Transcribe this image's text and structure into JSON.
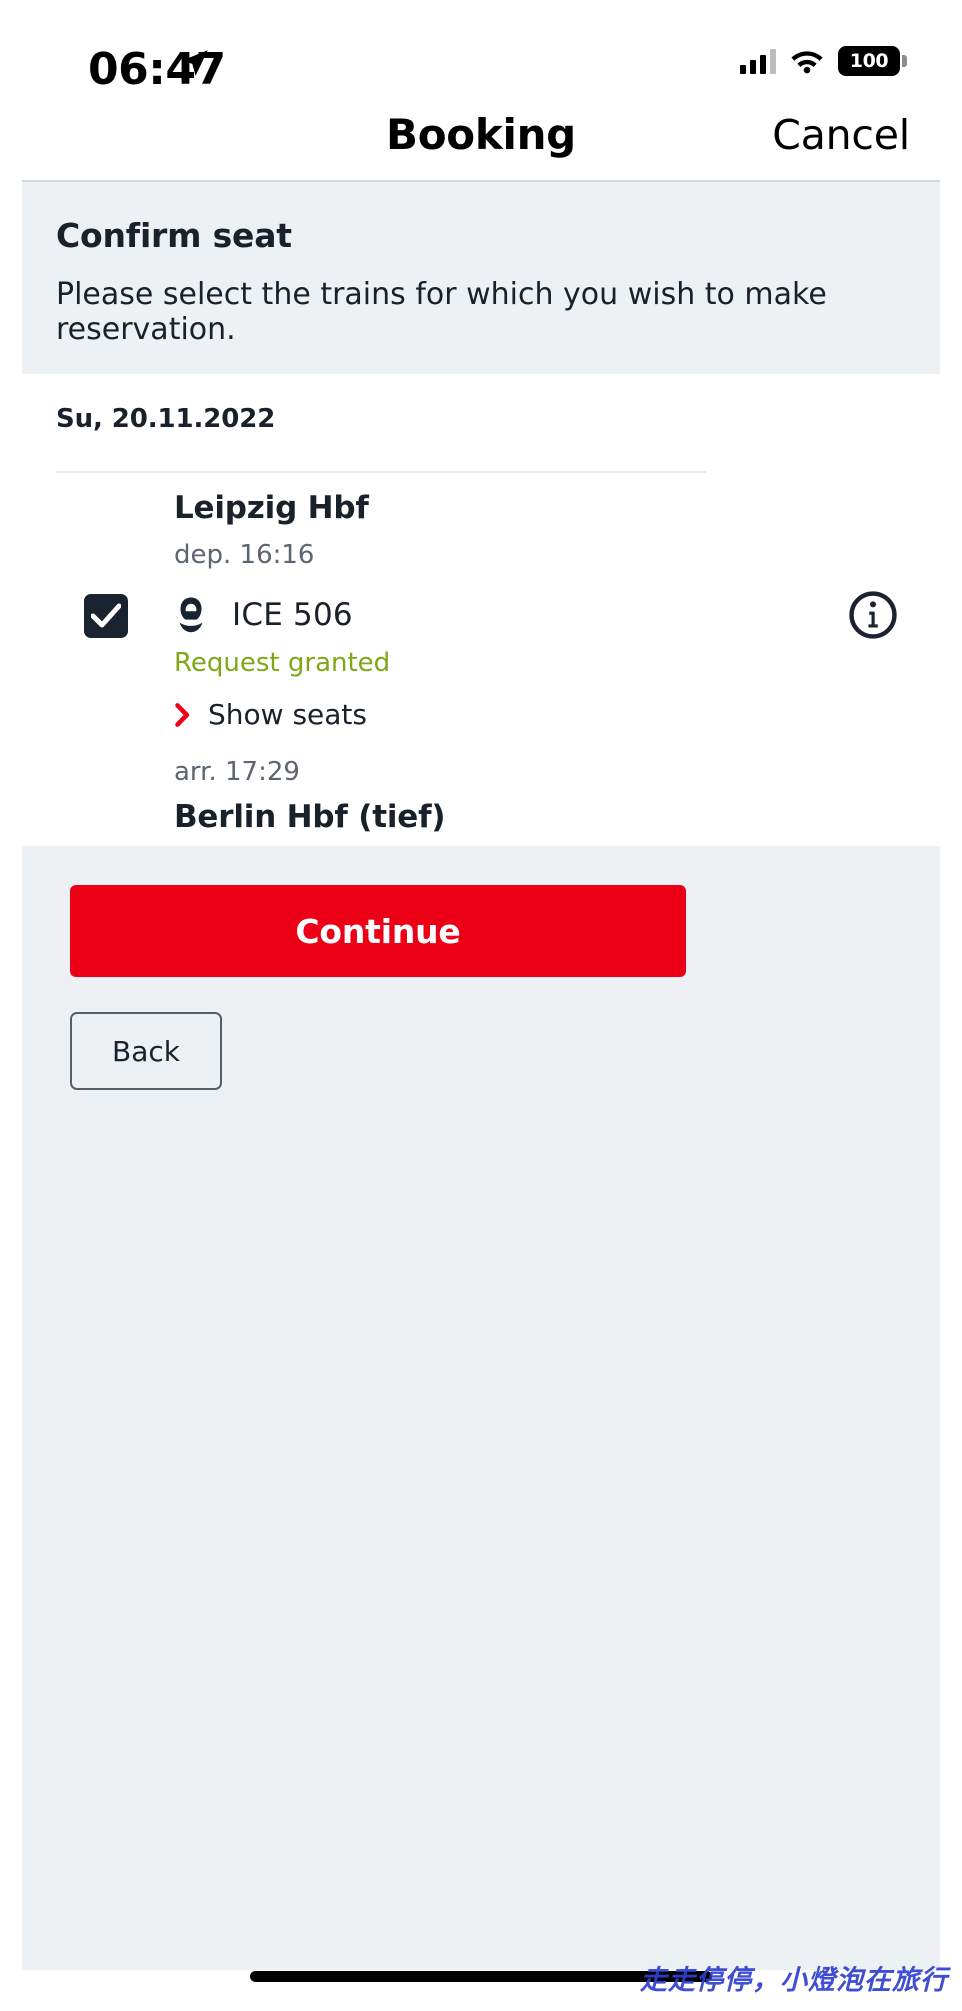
{
  "status_bar": {
    "time": "06:47",
    "location_icon": "location-arrow-icon",
    "signal_icon": "cellular-signal-icon",
    "wifi_icon": "wifi-icon",
    "battery_level": "100"
  },
  "nav": {
    "title": "Booking",
    "cancel_label": "Cancel"
  },
  "banner": {
    "title": "Confirm seat",
    "text": "Please select the trains for which you wish to make reservation."
  },
  "date_header": {
    "label": "Su, 20.11.2022"
  },
  "trip": {
    "checkbox_checked": true,
    "departure_station": "Leipzig Hbf",
    "departure_time": "dep. 16:16",
    "train_icon": "ice-train-icon",
    "train_name": "ICE 506",
    "status_text": "Request granted",
    "show_seats_label": "Show seats",
    "show_seats_chevron": "chevron-right-icon",
    "info_icon": "info-circle-icon",
    "arrival_time": "arr. 17:29",
    "arrival_station": "Berlin Hbf (tief)"
  },
  "actions": {
    "continue_label": "Continue",
    "back_label": "Back"
  },
  "watermark": {
    "text": "走走停停，小燈泡在旅行"
  },
  "colors": {
    "brand_red": "#ec0016",
    "banner_bg": "#eef1f4",
    "success_green": "#7fa717",
    "text_dark": "#19212a",
    "text_muted": "#5c6670"
  }
}
